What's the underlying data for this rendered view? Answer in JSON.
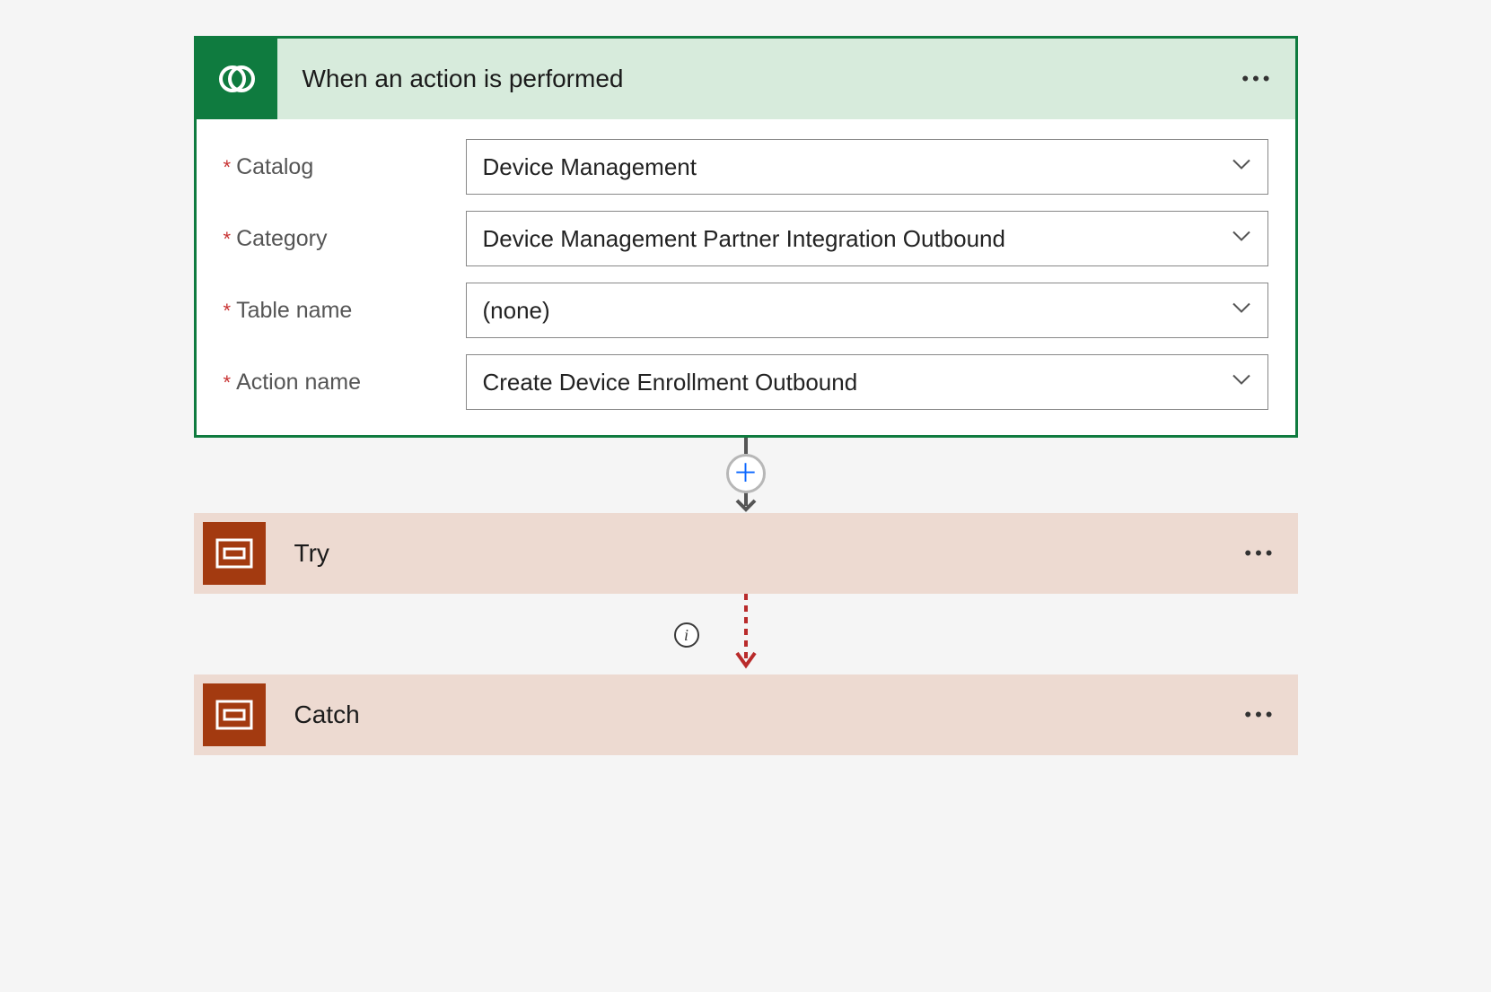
{
  "trigger": {
    "title": "When an action is performed",
    "fields": {
      "catalog": {
        "label": "Catalog",
        "value": "Device Management"
      },
      "category": {
        "label": "Category",
        "value": "Device Management Partner Integration Outbound"
      },
      "table": {
        "label": "Table name",
        "value": "(none)"
      },
      "action": {
        "label": "Action name",
        "value": "Create Device Enrollment Outbound"
      }
    }
  },
  "steps": {
    "try": {
      "title": "Try"
    },
    "catch": {
      "title": "Catch"
    }
  },
  "colors": {
    "triggerAccent": "#0f7b3f",
    "triggerHeaderBg": "#d7ebdc",
    "stepAccent": "#a33a10",
    "stepBg": "#eddad1",
    "errorArrow": "#b92b2b"
  }
}
